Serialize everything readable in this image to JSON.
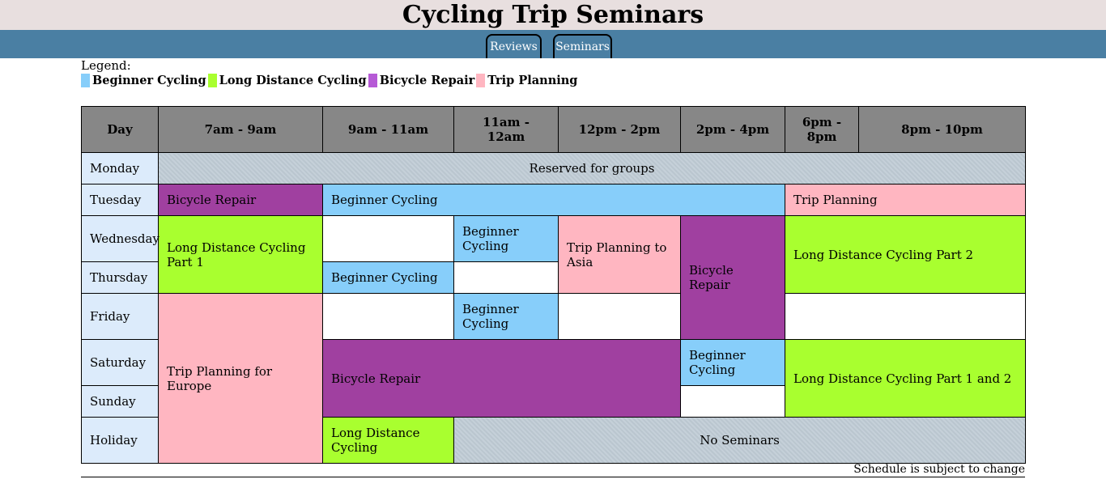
{
  "header": {
    "title": "Cycling Trip Seminars"
  },
  "nav": {
    "tabs": [
      {
        "label": "Reviews"
      },
      {
        "label": "Seminars"
      }
    ]
  },
  "legend": {
    "title": "Legend:",
    "items": [
      {
        "label": "Beginner Cycling",
        "color": "#87cefa"
      },
      {
        "label": "Long Distance Cycling",
        "color": "#a9ff2f"
      },
      {
        "label": "Bicycle Repair",
        "color": "#b65ad6"
      },
      {
        "label": "Trip Planning",
        "color": "#ffb6c1"
      }
    ]
  },
  "schedule": {
    "columns": [
      "Day",
      "7am - 9am",
      "9am - 11am",
      "11am - 12am",
      "12pm - 2pm",
      "2pm - 4pm",
      "6pm - 8pm",
      "8pm - 10pm"
    ],
    "days": [
      "Monday",
      "Tuesday",
      "Wednesday",
      "Thursday",
      "Friday",
      "Saturday",
      "Sunday",
      "Holiday"
    ],
    "cells": {
      "mon_reserved": "Reserved for groups",
      "tue_repair": "Bicycle Repair",
      "tue_beginner": "Beginner Cycling",
      "tue_planning": "Trip Planning",
      "wed_long1": "Long Distance Cycling Part 1",
      "wed_beginner": "Beginner Cycling",
      "wed_asia": "Trip Planning to Asia",
      "wed_repair": "Bicycle Repair",
      "wed_long2": "Long Distance Cycling Part 2",
      "thu_beginner": "Beginner Cycling",
      "fri_europe": "Trip Planning for Europe",
      "fri_beginner": "Beginner Cycling",
      "sat_repair": "Bicycle Repair",
      "sat_beginner": "Beginner Cycling",
      "sat_long": "Long Distance Cycling Part 1 and 2",
      "hol_long": "Long Distance Cycling",
      "hol_none": "No Seminars"
    }
  },
  "footer": {
    "note": "Schedule is subject to change"
  },
  "colors": {
    "header_bg": "#e8dfdf",
    "nav_bg": "#4a7fa3",
    "table_header_bg": "#878787",
    "day_bg": "#dcebfb",
    "beginner": "#87cefa",
    "long_distance": "#a9ff2f",
    "repair": "#a040a0",
    "planning": "#ffb6c1",
    "reserved": "#c0ccd6"
  }
}
